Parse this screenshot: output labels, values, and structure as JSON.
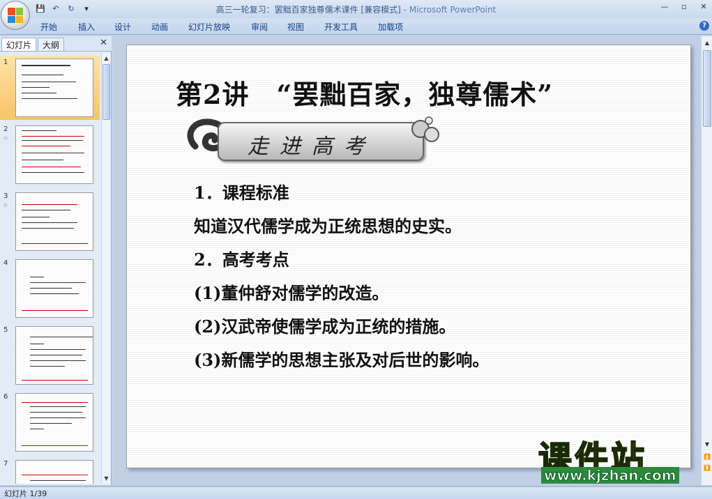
{
  "window": {
    "title": "高三一轮复习：罢黜百家独尊儒术课件 [兼容模式]",
    "app_name": "- Microsoft PowerPoint",
    "controls": [
      "—",
      "▫",
      "✕"
    ]
  },
  "qat": {
    "save": "💾",
    "undo": "↶",
    "redo": "↻",
    "more": "▾"
  },
  "ribbon": {
    "tabs": [
      "开始",
      "插入",
      "设计",
      "动画",
      "幻灯片放映",
      "审阅",
      "视图",
      "开发工具",
      "加载项"
    ],
    "help": "?"
  },
  "panel": {
    "tabs": [
      "幻灯片",
      "大纲"
    ],
    "close": "✕",
    "slides": [
      {
        "number": "1",
        "star": ""
      },
      {
        "number": "2",
        "star": "☆"
      },
      {
        "number": "3",
        "star": "☆"
      },
      {
        "number": "4",
        "star": ""
      },
      {
        "number": "5",
        "star": ""
      },
      {
        "number": "6",
        "star": ""
      },
      {
        "number": "7",
        "star": ""
      }
    ]
  },
  "slide": {
    "title": "第2讲　“罢黜百家，独尊儒术”",
    "banner": "走进高考",
    "lines": [
      "1．课程标准",
      "知道汉代儒学成为正统思想的史实。",
      "2．高考考点",
      "(1)董仲舒对儒学的改造。",
      "(2)汉武帝使儒学成为正统的措施。",
      "(3)新儒学的思想主张及对后世的影响。"
    ]
  },
  "watermark": {
    "main": "课件站",
    "url": "www.kjzhan.com"
  },
  "status": {
    "slide_count": "幻灯片 1/39"
  },
  "colors": {
    "ribbon_text": "#15428b",
    "selected_thumb": "#f8c466",
    "watermark_yellow": "#f3e61c"
  }
}
